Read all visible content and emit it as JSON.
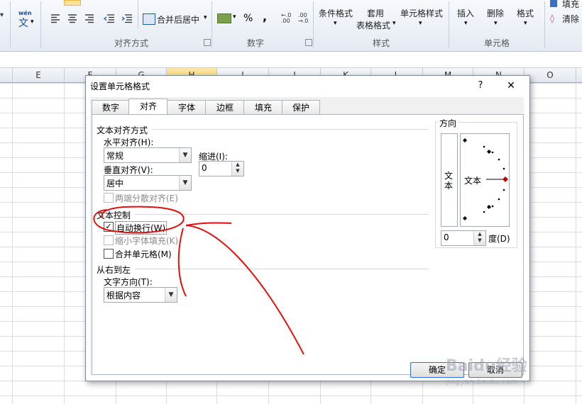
{
  "ribbon": {
    "alignment_group_label": "对齐方式",
    "number_group_label": "数字",
    "styles_group_label": "样式",
    "cells_group_label": "单元格",
    "merge_center_label": "合并后居中",
    "wen_label": "wén",
    "wen_char": "文",
    "percent_symbol": "%",
    "comma_symbol": ",",
    "cond_format_label": "条件格式",
    "table_format_label_1": "套用",
    "table_format_label_2": "表格格式",
    "cell_style_label": "单元格样式",
    "insert_label": "插入",
    "delete_label": "删除",
    "format_label": "格式",
    "fill_label": "填充",
    "clear_label": "清除"
  },
  "columns": [
    "E",
    "F",
    "G",
    "H",
    "I",
    "J",
    "K",
    "L",
    "M",
    "N",
    "O"
  ],
  "dialog": {
    "title": "设置单元格格式",
    "help": "?",
    "close": "✕",
    "tabs": [
      "数字",
      "对齐",
      "字体",
      "边框",
      "填充",
      "保护"
    ],
    "active_tab": "对齐",
    "text_alignment_section": "文本对齐方式",
    "horizontal_label": "水平对齐(H):",
    "horizontal_value": "常规",
    "indent_label": "缩进(I):",
    "indent_value": "0",
    "vertical_label": "垂直对齐(V):",
    "vertical_value": "居中",
    "distributed_label": "两端分散对齐(E)",
    "text_control_section": "文本控制",
    "wrap_text_label": "自动换行(W)",
    "wrap_text_checked": true,
    "shrink_label": "缩小字体填充(K)",
    "merge_label": "合并单元格(M)",
    "rtl_section": "从右到左",
    "text_direction_label": "文字方向(T):",
    "text_direction_value": "根据内容",
    "orientation_section": "方向",
    "vertical_text": "文本",
    "orientation_text": "文本",
    "degrees_value": "0",
    "degrees_label": "度(D)",
    "ok_label": "确定",
    "cancel_label": "取消"
  },
  "watermark": {
    "brand": "Baidu经验",
    "url": "jingyan.baidu.com"
  },
  "colors": {
    "annotation_red": "#e01010",
    "ribbon_bg": "#e4eaf3",
    "selected_column": "#f7d56b"
  }
}
